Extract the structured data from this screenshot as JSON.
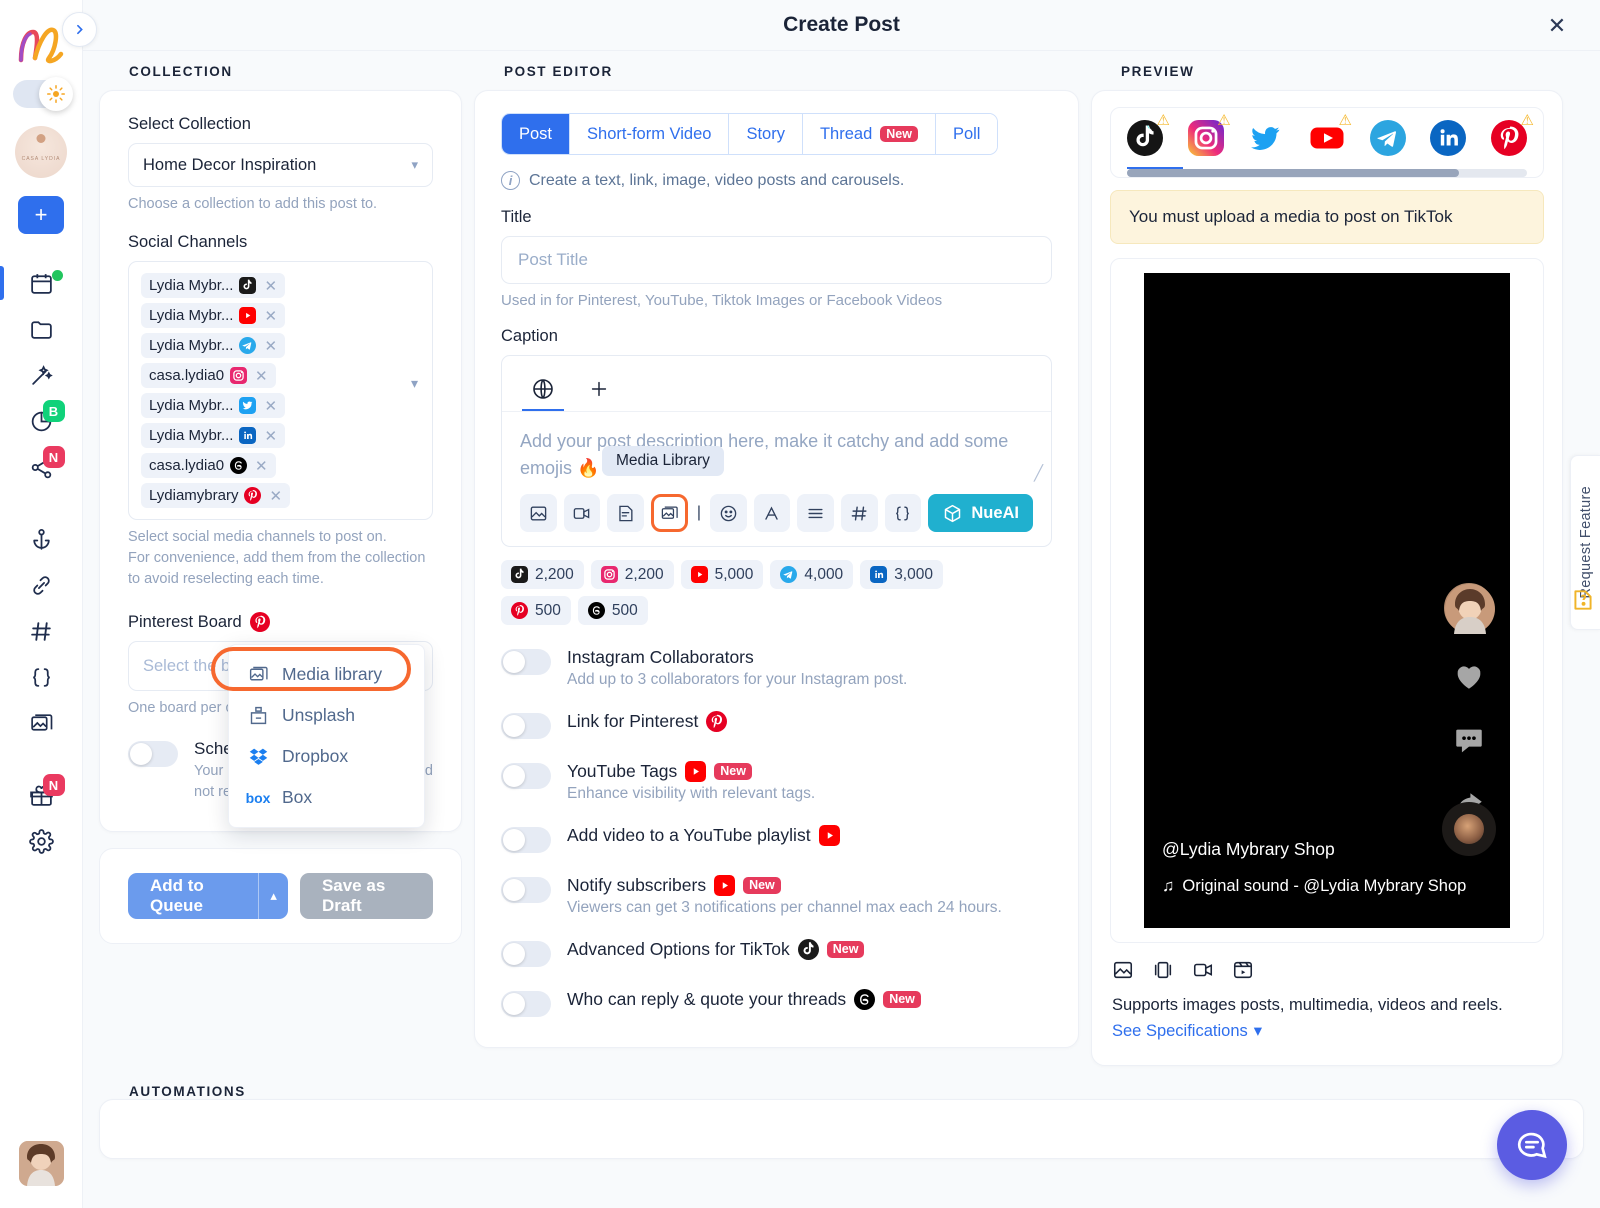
{
  "rail": {
    "logo_name": "nl-logo",
    "theme_toggle": "sun-icon",
    "add_label": "+",
    "items": [
      {
        "name": "calendar",
        "badge": ""
      },
      {
        "name": "folder",
        "badge": ""
      },
      {
        "name": "magic-wand",
        "badge": ""
      },
      {
        "name": "analytics",
        "badge": "B"
      },
      {
        "name": "share",
        "badge": "N"
      },
      {
        "name": "anchor",
        "badge": ""
      },
      {
        "name": "link",
        "badge": ""
      },
      {
        "name": "hashtag",
        "badge": ""
      },
      {
        "name": "curly-braces",
        "badge": ""
      },
      {
        "name": "media",
        "badge": ""
      },
      {
        "name": "gift",
        "badge": "N"
      },
      {
        "name": "settings",
        "badge": ""
      }
    ]
  },
  "modal": {
    "title": "Create Post",
    "close_label": "✕"
  },
  "collection": {
    "section_label": "COLLECTION",
    "select_collection_label": "Select Collection",
    "selected_collection": "Home Decor Inspiration",
    "collection_hint": "Choose a collection to add this post to.",
    "social_channels_label": "Social Channels",
    "channels": [
      {
        "name": "Lydia Mybr...",
        "network": "tiktok"
      },
      {
        "name": "Lydia Mybr...",
        "network": "youtube"
      },
      {
        "name": "Lydia Mybr...",
        "network": "telegram"
      },
      {
        "name": "casa.lydia0",
        "network": "instagram"
      },
      {
        "name": "Lydia Mybr...",
        "network": "twitter"
      },
      {
        "name": "Lydia Mybr...",
        "network": "linkedin"
      },
      {
        "name": "casa.lydia0",
        "network": "threads"
      },
      {
        "name": "Lydiamybrary",
        "network": "pinterest"
      }
    ],
    "channels_hint_1": "Select social media channels to post on.",
    "channels_hint_2": "For convenience, add them from the collection to avoid reselecting each time.",
    "pinterest_board_label": "Pinterest Board",
    "pinterest_board_placeholder": "Select the boards to post on",
    "pinterest_hint": "One board per channel can be selected.",
    "schedule_once_title": "Schedule once",
    "schedule_once_sub": "Your post will be scheduled once and not repeated.",
    "add_to_queue_label": "Add to Queue",
    "save_draft_label": "Save as Draft"
  },
  "editor": {
    "section_label": "POST EDITOR",
    "tabs": [
      {
        "label": "Post",
        "badge": "",
        "active": true
      },
      {
        "label": "Short-form Video",
        "badge": "",
        "active": false
      },
      {
        "label": "Story",
        "badge": "",
        "active": false
      },
      {
        "label": "Thread",
        "badge": "New",
        "active": false
      },
      {
        "label": "Poll",
        "badge": "",
        "active": false
      }
    ],
    "tab_note": "Create a text, link, image, video posts and carousels.",
    "title_label": "Title",
    "title_placeholder": "Post Title",
    "title_hint": "Used in for Pinterest, YouTube, Tiktok Images or Facebook Videos",
    "caption_label": "Caption",
    "caption_placeholder": "Add your post description here, make it catchy and add some emojis 🔥",
    "media_tooltip": "Media Library",
    "nueai_label": "NueAI",
    "toolbar_icons": [
      "image-icon",
      "video-icon",
      "document-icon",
      "media-library-icon",
      "emoji-icon",
      "font-icon",
      "align-icon",
      "hashtag-icon",
      "variables-icon"
    ],
    "counters": [
      {
        "network": "tiktok",
        "value": "2,200"
      },
      {
        "network": "instagram",
        "value": "2,200"
      },
      {
        "network": "youtube",
        "value": "5,000"
      },
      {
        "network": "telegram",
        "value": "4,000"
      },
      {
        "network": "linkedin",
        "value": "3,000"
      },
      {
        "network": "pinterest",
        "value": "500"
      },
      {
        "network": "threads",
        "value": "500"
      }
    ],
    "media_dropdown": [
      {
        "label": "Media library",
        "icon": "media-library-icon",
        "highlighted": true
      },
      {
        "label": "Unsplash",
        "icon": "unsplash-icon",
        "highlighted": false
      },
      {
        "label": "Dropbox",
        "icon": "dropbox-icon",
        "highlighted": false
      },
      {
        "label": "Box",
        "icon": "box-icon",
        "highlighted": false
      }
    ],
    "options": [
      {
        "title": "Instagram Collaborators",
        "network": "instagram",
        "badge": "",
        "sub": "Add up to 3 collaborators for your Instagram post."
      },
      {
        "title": "Link for Pinterest",
        "network": "pinterest",
        "badge": "",
        "sub": ""
      },
      {
        "title": "YouTube Tags",
        "network": "youtube",
        "badge": "New",
        "sub": "Enhance visibility with relevant tags."
      },
      {
        "title": "Add video to a YouTube playlist",
        "network": "youtube",
        "badge": "",
        "sub": ""
      },
      {
        "title": "Notify subscribers",
        "network": "youtube",
        "badge": "New",
        "sub": "Viewers can get 3 notifications per channel max each 24 hours."
      },
      {
        "title": "Advanced Options for TikTok",
        "network": "tiktok",
        "badge": "New",
        "sub": ""
      },
      {
        "title": "Who can reply & quote your threads",
        "network": "threads",
        "badge": "New",
        "sub": ""
      }
    ]
  },
  "preview": {
    "section_label": "PREVIEW",
    "channel_icons": [
      {
        "network": "tiktok",
        "warning": true,
        "active": true
      },
      {
        "network": "instagram",
        "warning": true,
        "active": false
      },
      {
        "network": "twitter",
        "warning": false,
        "active": false
      },
      {
        "network": "youtube",
        "warning": true,
        "active": false
      },
      {
        "network": "telegram",
        "warning": false,
        "active": false
      },
      {
        "network": "linkedin",
        "warning": false,
        "active": false
      },
      {
        "network": "pinterest",
        "warning": true,
        "active": false
      }
    ],
    "warning_text": "You must upload a media to post on TikTok",
    "handle": "@Lydia Mybrary Shop",
    "sound": "Original sound - @Lydia Mybrary Shop",
    "footer_icons": [
      "image-icon",
      "carousel-icon",
      "video-icon",
      "reels-icon"
    ],
    "supports_text": "Supports images posts, multimedia, videos and reels.",
    "see_specifications": "See Specifications"
  },
  "automations": {
    "section_label": "AUTOMATIONS"
  },
  "request_feature": {
    "label": "Request Feature"
  },
  "colors": {
    "accent": "#2f6fed",
    "highlight": "#f6682f",
    "nueai": "#20b0cf",
    "badge_new": "#e63a5c",
    "warning_bg": "#fdf4dd"
  }
}
